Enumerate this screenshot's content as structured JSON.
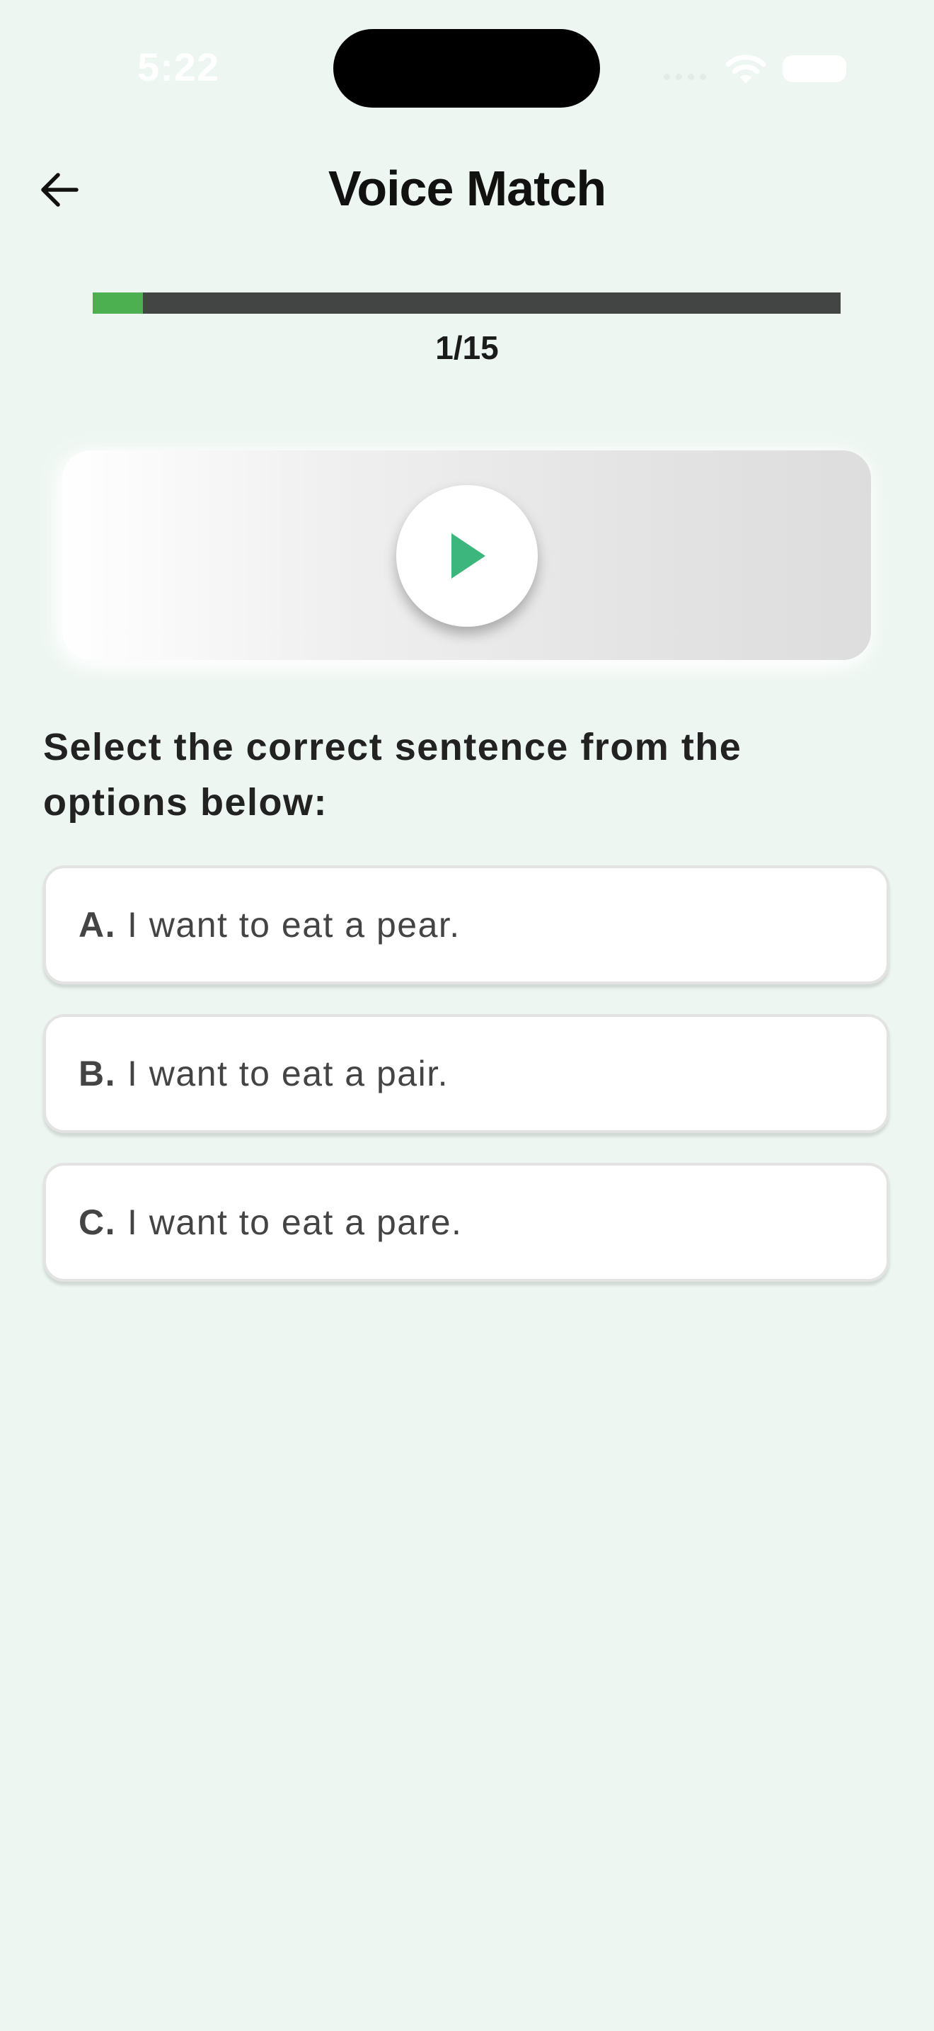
{
  "status_bar": {
    "time": "5:22"
  },
  "header": {
    "title": "Voice Match",
    "back_icon": "arrow-left-icon"
  },
  "progress": {
    "label": "1/15",
    "current": 1,
    "total": 15,
    "fraction": 0.067,
    "fill_color": "#4CAF50",
    "track_color": "#424544"
  },
  "audio": {
    "play_icon": "play-icon",
    "icon_color": "#3DB67E"
  },
  "question": {
    "text": "Select the correct sentence from the options below:"
  },
  "options": [
    {
      "letter": "A.",
      "text": "I want to eat a pear."
    },
    {
      "letter": "B.",
      "text": "I want to eat a pair."
    },
    {
      "letter": "C.",
      "text": "I want to eat a pare."
    }
  ],
  "colors": {
    "background": "#EDF6F1",
    "accent": "#3DB67E"
  }
}
